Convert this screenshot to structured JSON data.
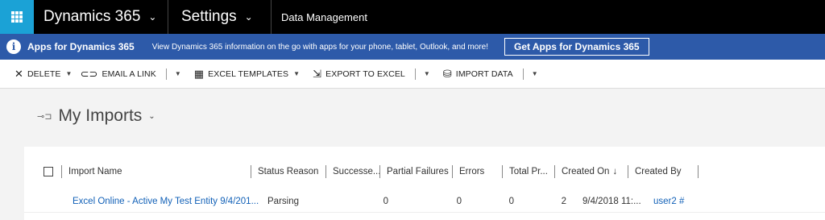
{
  "topnav": {
    "app_name": "Dynamics 365",
    "section": "Settings",
    "area": "Data Management"
  },
  "banner": {
    "title": "Apps for Dynamics 365",
    "text": "View Dynamics 365 information on the go with apps for your phone, tablet, Outlook, and more!",
    "button": "Get Apps for Dynamics 365"
  },
  "commands": {
    "delete": "DELETE",
    "email_link": "EMAIL A LINK",
    "excel_templates": "EXCEL TEMPLATES",
    "export_excel": "EXPORT TO EXCEL",
    "import_data": "IMPORT DATA"
  },
  "view": {
    "title": "My Imports"
  },
  "grid": {
    "columns": [
      "Import Name",
      "Status Reason",
      "Successe...",
      "Partial Failures",
      "Errors",
      "Total Pr...",
      "Created On",
      "Created By"
    ],
    "rows": [
      {
        "import_name": "Excel Online - Active My Test Entity 9/4/201...",
        "status_reason": "Parsing",
        "successes": "0",
        "partial_failures": "0",
        "errors": "0",
        "total": "2",
        "created_on": "9/4/2018 11:...",
        "created_by": "user2 #"
      }
    ]
  },
  "colors": {
    "nav_bg": "#000000",
    "waffle_bg": "#1ba2d6",
    "banner_bg": "#2d5aa9",
    "link": "#1160b7"
  },
  "icons": [
    "waffle-icon",
    "chevron-down-icon",
    "info-icon",
    "close-x-icon",
    "link-icon",
    "excel-icon",
    "export-icon",
    "import-icon",
    "pin-icon",
    "sort-down-icon"
  ]
}
